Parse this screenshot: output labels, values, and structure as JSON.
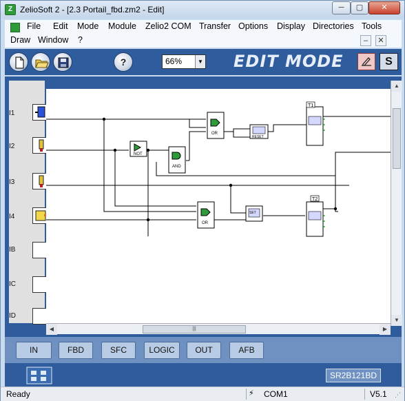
{
  "window": {
    "title": "ZelioSoft 2 - [2.3 Portail_fbd.zm2 - Edit]",
    "app_icon": "zeliosoft-app-icon",
    "controls": {
      "minimize": "─",
      "maximize": "▢",
      "close": "✕"
    }
  },
  "menu": {
    "row1": [
      "File",
      "Edit",
      "Mode",
      "Module",
      "Zelio2 COM",
      "Transfer",
      "Options",
      "Display",
      "Directories",
      "Tools"
    ],
    "row2": [
      "Draw",
      "Window",
      "?"
    ],
    "mdi": {
      "minimize": "–",
      "close": "✕"
    }
  },
  "toolbar": {
    "new_icon": "new-document-icon",
    "open_icon": "open-folder-icon",
    "save_icon": "save-disk-icon",
    "help_icon": "help-icon",
    "help_glyph": "?",
    "zoom": "66%",
    "mode_label": "EDIT MODE",
    "edit_mode_icon": "edit-mode-icon",
    "simulation_label": "S"
  },
  "editor": {
    "inputs": [
      {
        "label": "I1"
      },
      {
        "label": "I2"
      },
      {
        "label": "I3"
      },
      {
        "label": "I4"
      },
      {
        "label": "IB"
      },
      {
        "label": "IC"
      },
      {
        "label": "ID"
      }
    ],
    "blocks": {
      "or1": "OR",
      "or2": "OR",
      "not": "NOT",
      "and": "AND",
      "setreset": "RESET",
      "setreset2": "SET",
      "t1": "T1",
      "t2": "T2"
    }
  },
  "function_tabs": [
    "IN",
    "FBD",
    "SFC",
    "LOGIC",
    "OUT",
    "AFB"
  ],
  "module_ref": "SR2B121BD",
  "status": {
    "ready": "Ready",
    "port": "COM1",
    "version": "V5.1"
  }
}
